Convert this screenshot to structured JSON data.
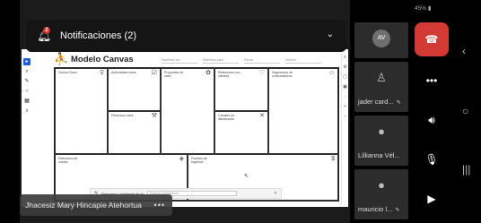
{
  "status": {
    "battery": "45%"
  },
  "notification": {
    "title": "Notificaciones (2)",
    "badge": "2"
  },
  "shared_screen": {
    "title": "Modelo Canvas",
    "meta_fields": [
      "Diseñado por",
      "Diseñado para",
      "Fecha",
      "Versión"
    ],
    "cells": {
      "socios": "Socios Clave",
      "actividades": "Actividades clave",
      "propuesta": "Propuesta de valor",
      "relaciones": "Relaciones con clientes",
      "segmentos": "Segmentos de consumidores",
      "recursos": "Recursos clave",
      "canales": "Canales de distribución",
      "costos": "Estructura de costos",
      "ingresos": "Fuentes de ingresos"
    },
    "feedback_text": "Pregunta o incidente de la",
    "feedback_placeholder": "Mostrar comentarios"
  },
  "presenter": {
    "name": "Jhacesiz Mary Hincapie Atehortua",
    "more": "•••"
  },
  "participants": [
    {
      "initials": "AV",
      "name": ""
    },
    {
      "initials": "",
      "name": "jader card..."
    },
    {
      "initials": "",
      "name": "Lillianna Vél..."
    },
    {
      "initials": "",
      "name": "mauricio l..."
    }
  ],
  "controls": {
    "end_call": "end-call-icon",
    "more": "•••",
    "speaker": "speaker-icon",
    "mic": "mic-muted-icon",
    "camera": "camera-off-icon"
  },
  "colors": {
    "end_call": "#d43a35",
    "badge": "#d9302b",
    "accent": "#1a5fd0"
  }
}
